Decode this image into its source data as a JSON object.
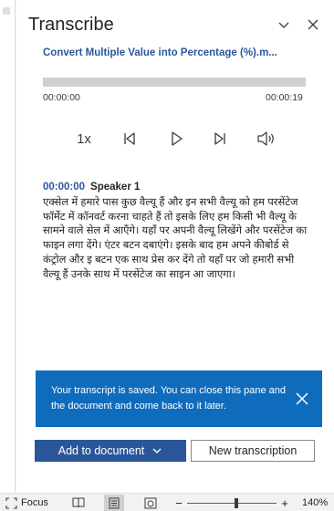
{
  "pane": {
    "title": "Transcribe",
    "file_name": "Convert Multiple Value into Percentage (%).m..."
  },
  "player": {
    "progress": 0.0,
    "time_start": "00:00:00",
    "time_end": "00:00:19",
    "speed": "1x"
  },
  "transcript": {
    "entries": [
      {
        "timestamp": "00:00:00",
        "speaker": "Speaker 1",
        "text": "एक्सेल में हमारे पास कुछ वैल्यू हैं और इन सभी वैल्यू को हम परसेंटेज फॉर्मेट में कॉनवर्ट करना चाहते हैं तो इसके लिए हम किसी भी वैल्यू के सामने वाले सेल में आएँगे। यहाँ पर अपनी वैल्यू लिखेंगे और परसेंटेज का फाइन लगा देंगे। एंटर बटन दबाएंगे। इसके बाद हम अपने कीबोर्ड से कंट्रोल और इ बटन एक साथ प्रेस कर देंगे तो यहाँ पर जो हमारी सभी वैल्यू हैं उनके साथ में परसेंटेज का साइन आ जाएगा।"
      }
    ]
  },
  "notification": {
    "message": "Your transcript is saved. You can close this pane and the document and come back to it later."
  },
  "actions": {
    "add_label": "Add to document",
    "new_label": "New transcription"
  },
  "statusbar": {
    "focus_label": "Focus",
    "zoom_minus": "−",
    "zoom_plus": "+",
    "zoom_level": "140%",
    "zoom_fraction": 0.55
  },
  "colors": {
    "accent": "#2b579a",
    "toast": "#0f6cbd"
  }
}
